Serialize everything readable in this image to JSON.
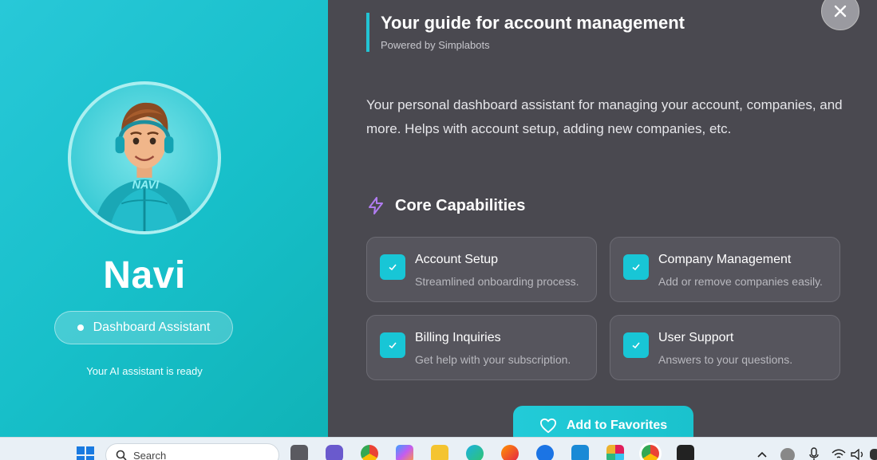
{
  "assistant": {
    "name": "Navi",
    "role": "Dashboard Assistant",
    "status": "Your AI assistant is ready",
    "badge_text": "NAVI"
  },
  "header": {
    "title": "Your guide for account management",
    "powered_by": "Powered by Simplabots"
  },
  "description": "Your personal dashboard assistant for managing your account, companies, and more. Helps with account setup, adding new companies, etc.",
  "capabilities": {
    "title": "Core Capabilities",
    "items": [
      {
        "title": "Account Setup",
        "desc": "Streamlined onboarding process."
      },
      {
        "title": "Company Management",
        "desc": "Add or remove companies easily."
      },
      {
        "title": "Billing Inquiries",
        "desc": "Get help with your subscription."
      },
      {
        "title": "User Support",
        "desc": "Answers to your questions."
      }
    ]
  },
  "actions": {
    "favorites_label": "Add to Favorites"
  },
  "taskbar": {
    "search_placeholder": "Search"
  },
  "colors": {
    "accent": "#1ac4d2",
    "left_panel": "#17bfc9",
    "right_panel": "#4a4950",
    "lightning": "#b07cf0"
  }
}
